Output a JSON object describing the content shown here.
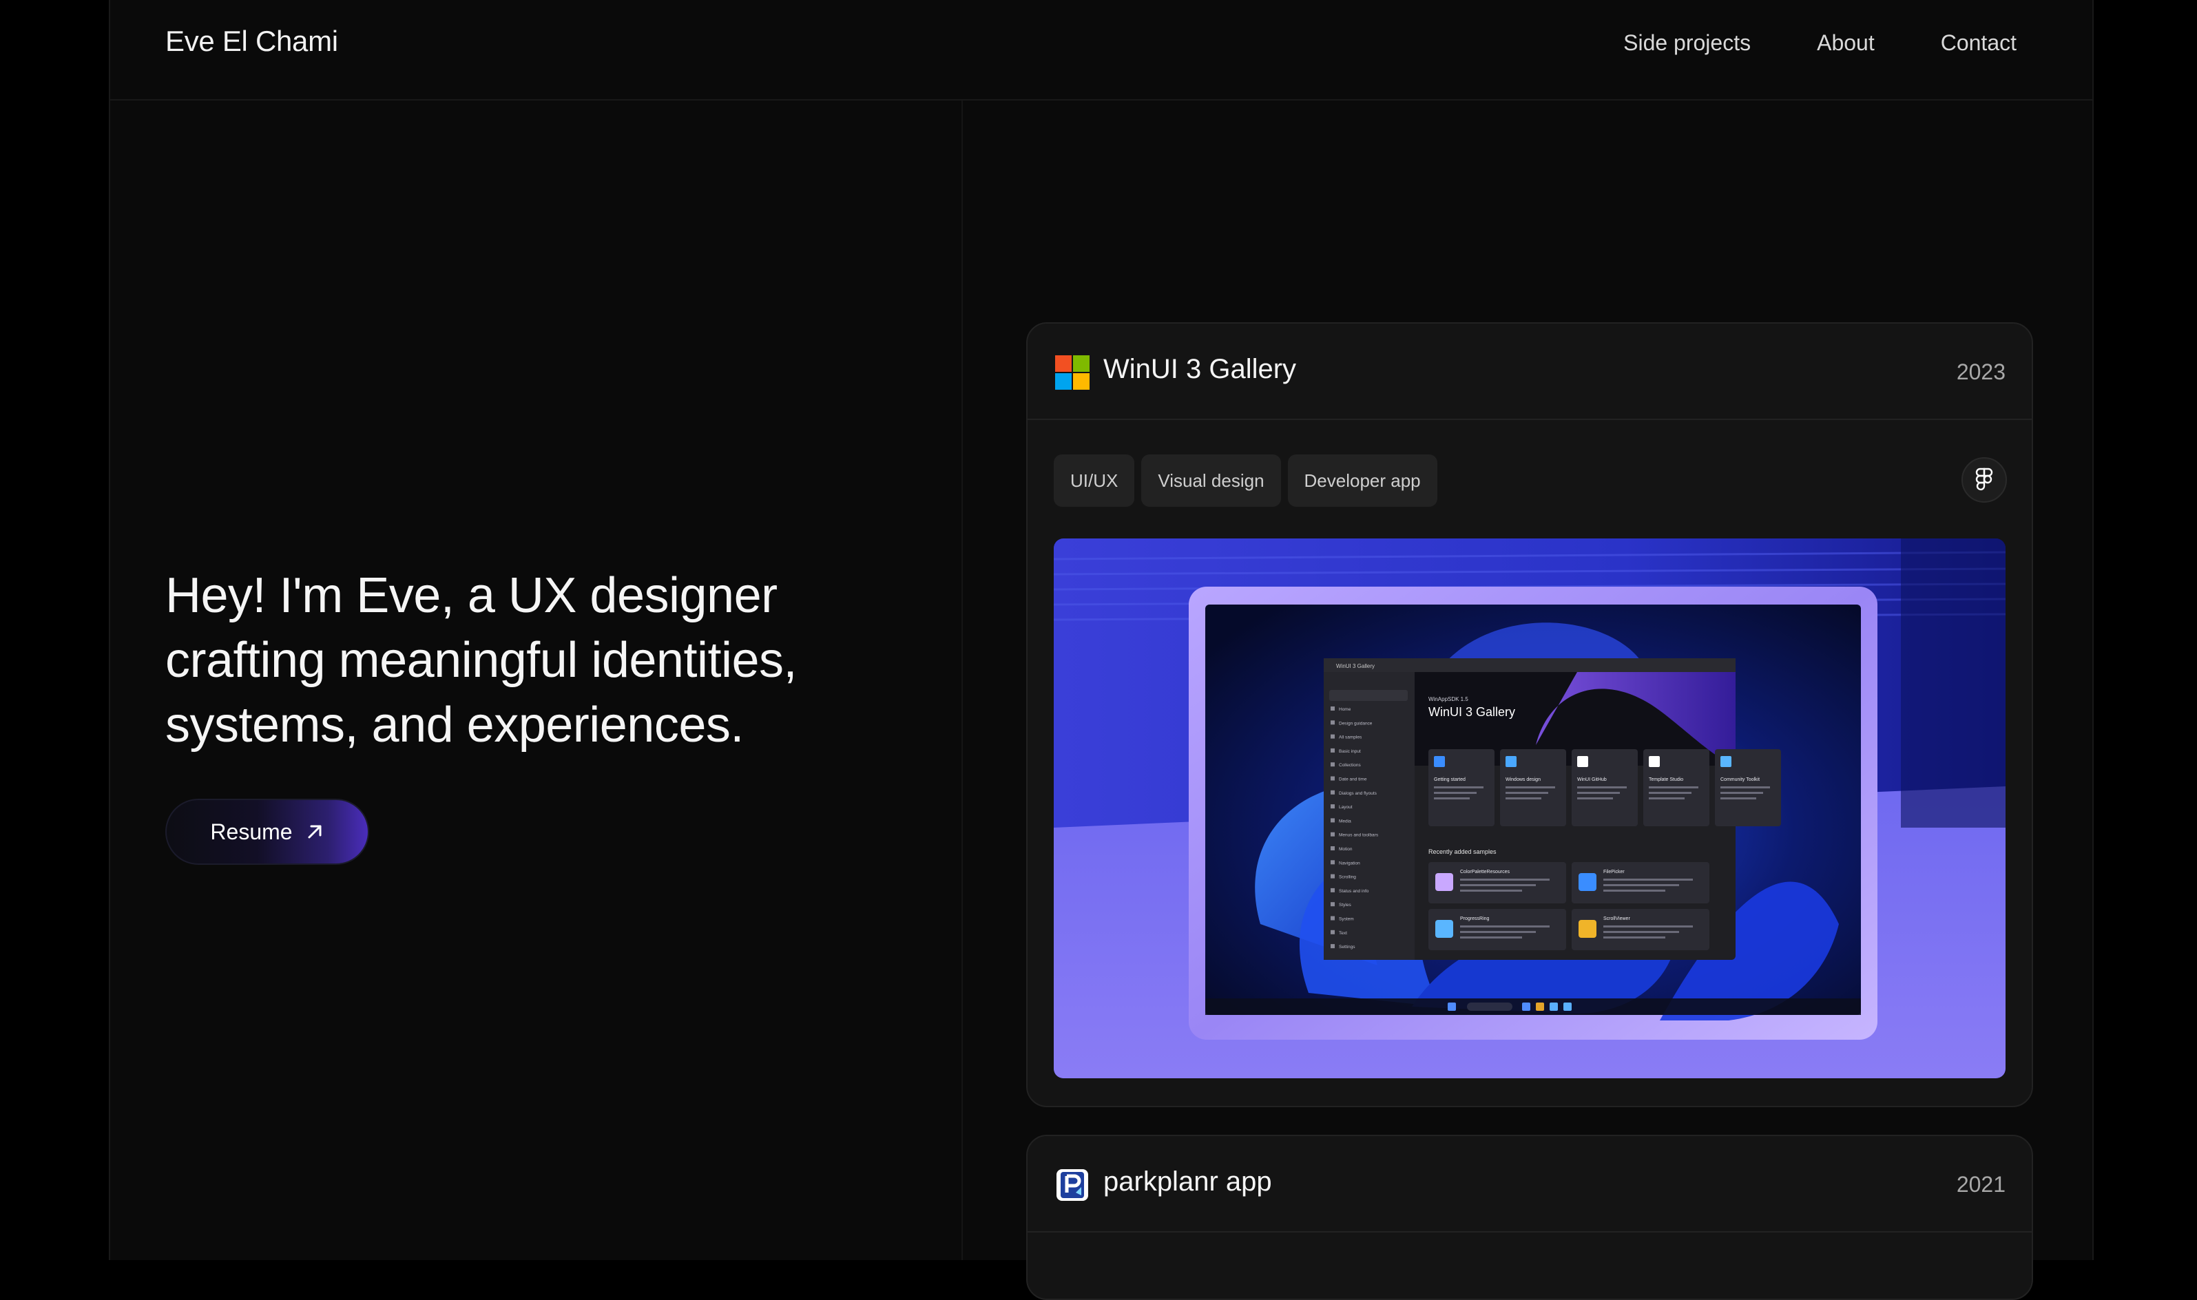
{
  "header": {
    "name": "Eve El Chami",
    "nav": [
      "Side projects",
      "About",
      "Contact"
    ]
  },
  "hero": {
    "lines": [
      "Hey! I'm Eve, a UX designer",
      "crafting meaningful identities,",
      "systems, and experiences."
    ],
    "resume_label": "Resume",
    "resume_icon": "arrow-up-right-icon"
  },
  "projects": [
    {
      "title": "WinUI 3 Gallery",
      "year": "2023",
      "icon": "microsoft-logo-icon",
      "tags": [
        "UI/UX",
        "Visual design",
        "Developer app"
      ],
      "link_icon": "figma-icon",
      "preview": {
        "app_kicker": "WinAppSDK 1.5",
        "app_title": "WinUI 3 Gallery",
        "tiles": [
          "Getting started",
          "Windows design",
          "WinUI GitHub",
          "Template Studio",
          "Community Toolkit"
        ],
        "recent_heading": "Recently added samples",
        "recent": [
          "ColorPaletteResources",
          "FilePicker",
          "ProgressRing",
          "ScrollViewer"
        ],
        "window_title": "WinUI 3 Gallery",
        "nav_items": [
          "Home",
          "Design guidance",
          "All samples",
          "Basic input",
          "Collections",
          "Date and time",
          "Dialogs and flyouts",
          "Layout",
          "Media",
          "Menus and toolbars",
          "Motion",
          "Navigation",
          "Scrolling",
          "Status and info",
          "Styles",
          "System",
          "Text",
          "Settings"
        ]
      }
    },
    {
      "title": "parkplanr app",
      "year": "2021",
      "icon": "parkplanr-logo-icon"
    }
  ],
  "colors": {
    "background": "#0a0a0a",
    "card": "#141414",
    "tag": "#222222",
    "accent_purple": "#4a2dbb"
  }
}
